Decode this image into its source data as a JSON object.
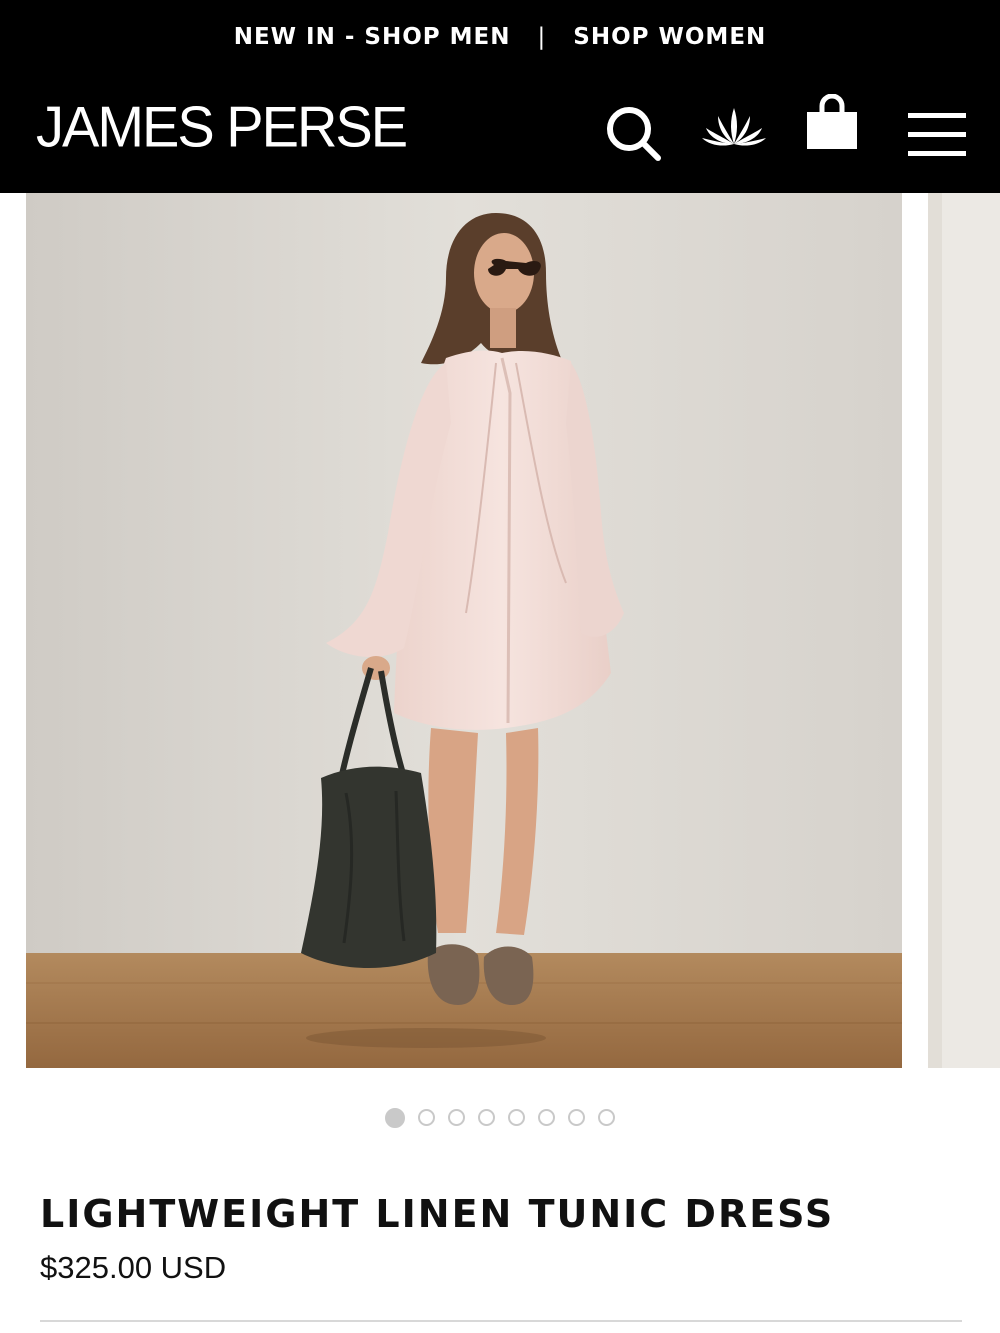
{
  "header": {
    "promo_new_in_shop_men": "NEW IN - SHOP MEN",
    "promo_separator": "|",
    "promo_shop_women": "SHOP WOMEN",
    "logo": "JAMES PERSE",
    "icons": [
      "search-icon",
      "lotus-icon",
      "shopping-bag-icon",
      "hamburger-menu-icon"
    ]
  },
  "gallery": {
    "image_count": 8,
    "active_index": 0
  },
  "product": {
    "name": "LIGHTWEIGHT LINEN TUNIC DRESS",
    "price": "$325.00 USD"
  },
  "colors": {
    "header_bg": "#000000",
    "header_text": "#ffffff",
    "dot_active": "#c9c9c9",
    "dress": "#f2dcd6",
    "wall": "#dcd8d2",
    "floor": "#a57a4e"
  }
}
